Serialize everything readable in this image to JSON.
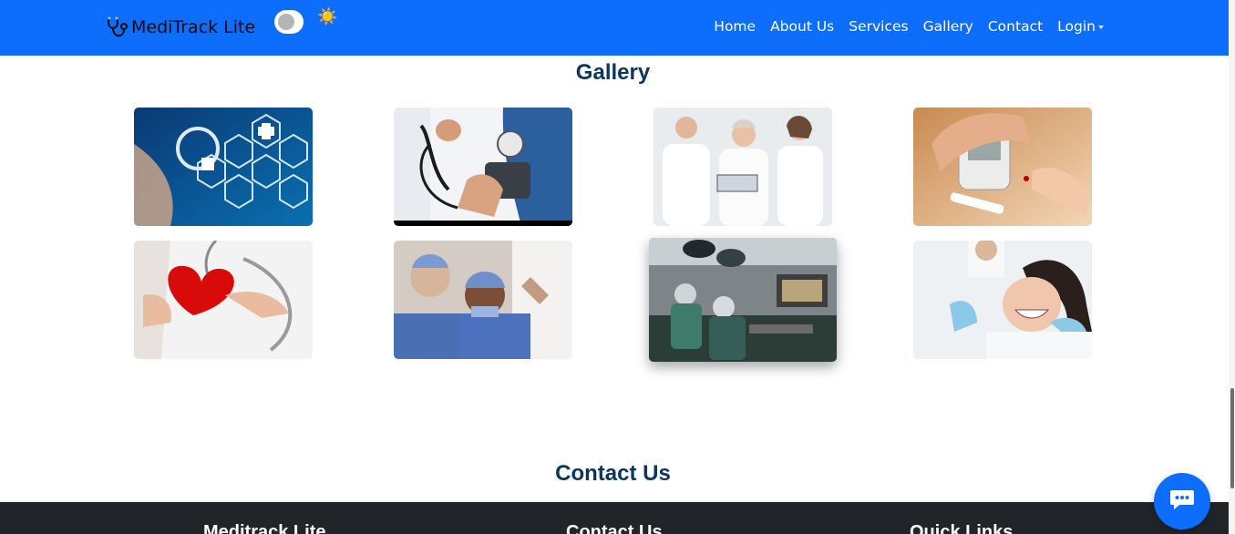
{
  "brand": {
    "name": "MediTrack Lite",
    "theme_icon": "☀️"
  },
  "nav": {
    "items": [
      "Home",
      "About Us",
      "Services",
      "Gallery",
      "Contact"
    ],
    "login_label": "Login"
  },
  "gallery": {
    "title": "Gallery",
    "images": [
      "medical-technology-hexagon-icons",
      "blood-pressure-measurement",
      "doctors-with-tablet",
      "glucose-meter-finger-test",
      "red-heart-with-stethoscope",
      "surgeons-in-scrubs",
      "operating-room-surgery",
      "dental-patient-smiling"
    ]
  },
  "contact": {
    "title": "Contact Us"
  },
  "footer": {
    "col1_heading": "Meditrack Lite",
    "col2_heading": "Contact Us",
    "col3_heading": "Quick Links"
  },
  "colors": {
    "primary": "#0d6efd",
    "title_navy": "#0b3660",
    "footer_bg": "#212529"
  }
}
